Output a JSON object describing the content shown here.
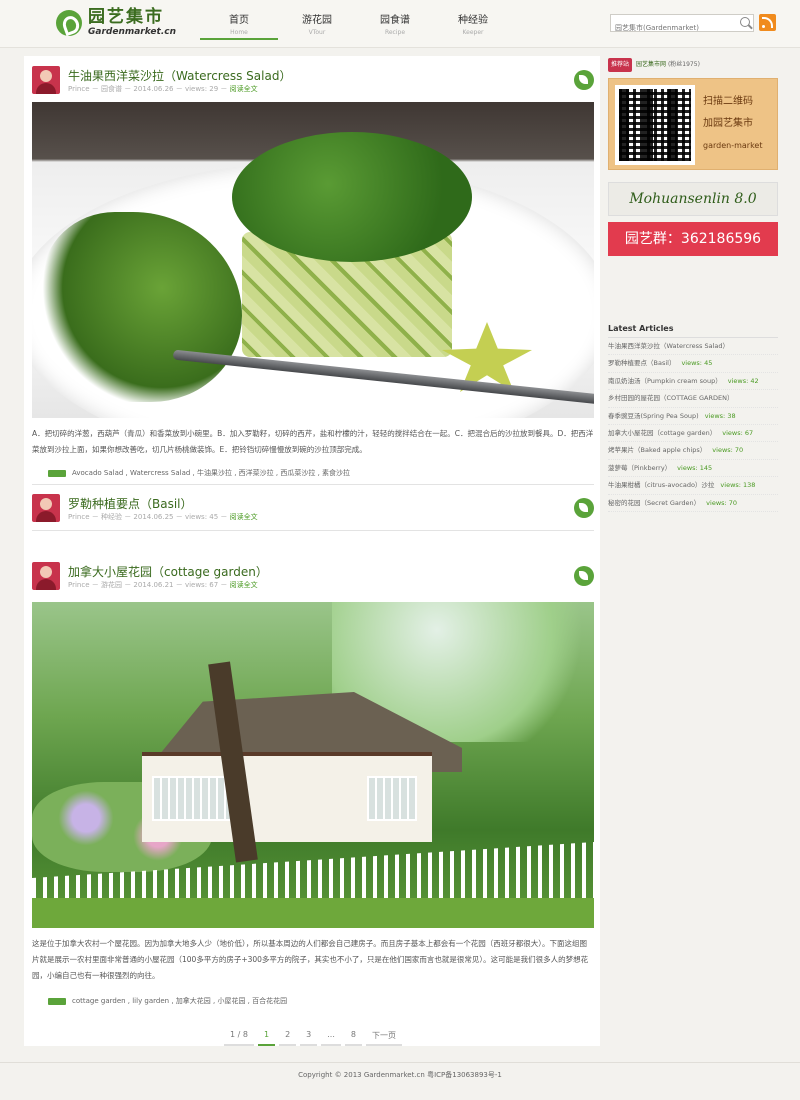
{
  "header": {
    "logo_cn": "园艺集市",
    "logo_en": "Gardenmarket.cn",
    "nav": [
      {
        "cn": "首页",
        "en": "Home"
      },
      {
        "cn": "游花园",
        "en": "VTour"
      },
      {
        "cn": "园食谱",
        "en": "Recipe"
      },
      {
        "cn": "种经验",
        "en": "Keeper"
      }
    ],
    "search_placeholder": "园艺集市(Gardenmarket)"
  },
  "posts": [
    {
      "title": "牛油果西洋菜沙拉（Watercress Salad）",
      "meta": "Prince － 园食谱 － 2014.06.26 － views: 29 － ",
      "read_more": "阅读全文",
      "text": "A．把切碎的洋葱，西葫芦（青瓜）和香菜放到小碗里。B．加入罗勒籽，切碎的西芹，盐和柠檬的汁，轻轻的搅拌结合在一起。C．把混合后的沙拉放到餐具。D．把西洋菜放到沙拉上面，如果你想改善吃，切几片杨桃做装饰。E．把铃铛切碎慢慢放到碗的沙拉顶部完成。",
      "tags": "Avocado Salad , Watercress Salad , 牛油果沙拉 , 西洋菜沙拉 , 西瓜菜沙拉 , 素食沙拉"
    },
    {
      "title": "罗勒种植要点（Basil）",
      "meta": "Prince － 种经验 － 2014.06.25 － views: 45 － ",
      "read_more": "阅读全文"
    },
    {
      "title": "加拿大小屋花园（cottage garden）",
      "meta": "Prince － 游花园 － 2014.06.21 － views: 67 － ",
      "read_more": "阅读全文",
      "text": "这是位于加拿大农村一个屋花园。因为加拿大地多人少（地价低），所以基本周边的人们都会自己建房子。而且房子基本上都会有一个花园（西班牙都很大）。下面这组图片就是展示一农村里面非常普通的小屋花园（100多平方的房子+300多平方的院子，其实也不小了，只是在他们国家而言也就是很常见）。这可能是我们很多人的梦想花园，小编自己也有一种很强烈的向往。",
      "tags": "cottage garden , lily garden , 加拿大花园 , 小屋花园 , 百合花花园"
    }
  ],
  "pagination": [
    "1 / 8",
    "1",
    "2",
    "3",
    "...",
    "8",
    "下一页"
  ],
  "sidebar": {
    "badge": "推荐站",
    "site": "园艺集市网",
    "site_note": "(粉丝1975)",
    "qr_line1": "扫描二维码",
    "qr_line2": "加园艺集市",
    "qr_line3": "garden-market",
    "brand": "Mohuansenlin 8.0",
    "group": "园艺群：362186596",
    "latest_title": "Latest Articles",
    "latest": [
      {
        "title": "牛油果西洋菜沙拉（Watercress Salad）",
        "views": ""
      },
      {
        "title": "罗勒种植要点（Basil）",
        "views": "views: 45"
      },
      {
        "title": "南瓜奶油汤（Pumpkin cream soup）",
        "views": "views: 42"
      },
      {
        "title": "乡村田园的屋花园（COTTAGE GARDEN）",
        "views": ""
      },
      {
        "title": "春季豌豆汤(Spring Pea Soup)",
        "views": "views: 38"
      },
      {
        "title": "加拿大小屋花园（cottage garden）",
        "views": "views: 67"
      },
      {
        "title": "烤苹果片（Baked apple chips）",
        "views": "views: 70"
      },
      {
        "title": "菠萝莓（Pinkberry）",
        "views": "views: 145"
      },
      {
        "title": "牛油果柑橘（citrus-avocado）沙拉",
        "views": "views: 138"
      },
      {
        "title": "秘密的花园（Secret Garden）",
        "views": "views: 70"
      }
    ]
  },
  "footer": "Copyright © 2013 Gardenmarket.cn 粤ICP备13063893号-1",
  "colors": {
    "accent": "#5aa33a",
    "title": "#3a6a1e",
    "group_red": "#e23b4e",
    "qr_bg": "#eec386"
  }
}
